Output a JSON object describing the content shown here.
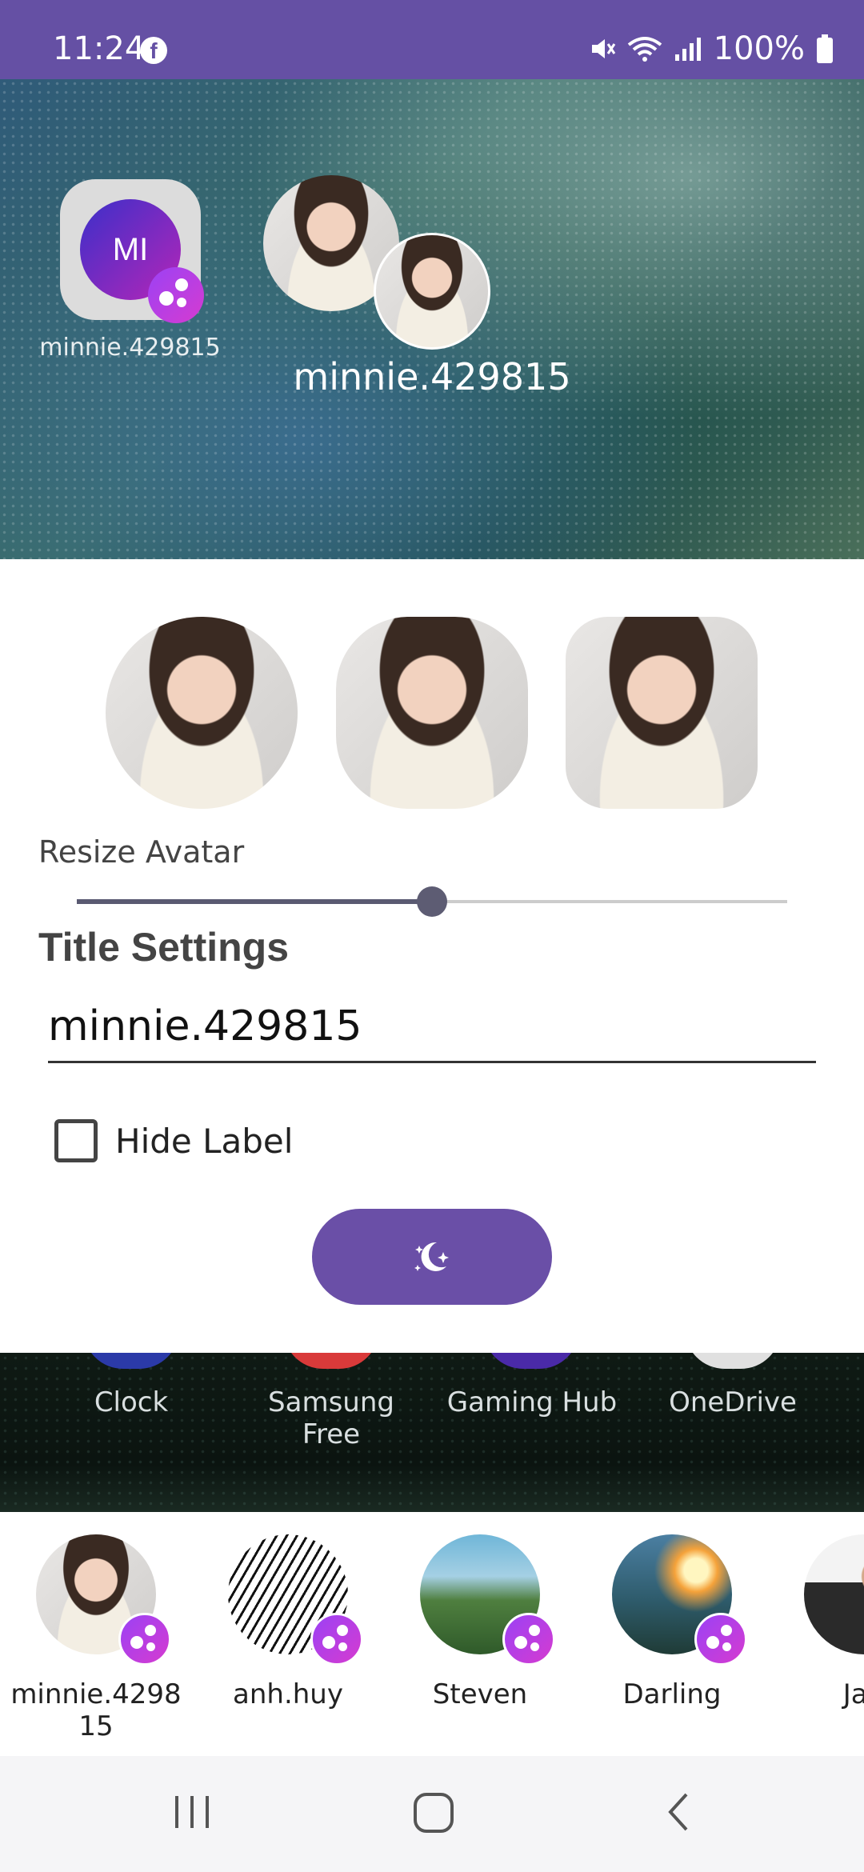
{
  "status_bar": {
    "time": "11:24",
    "battery": "100%",
    "icons": [
      "facebook-icon",
      "mute-icon",
      "wifi-icon",
      "signal-icon",
      "battery-icon"
    ],
    "background": "#6550a4"
  },
  "preview": {
    "widget_initials": "MI",
    "widget_label": "minnie.429815",
    "title": "minnie.429815"
  },
  "settings": {
    "shape_options": [
      "circle",
      "squircle",
      "rounded-square"
    ],
    "resize_label": "Resize Avatar",
    "resize_value": 0.5,
    "title_heading": "Title Settings",
    "title_value": "minnie.429815",
    "hide_label": "Hide Label",
    "hide_label_checked": false,
    "apply_icon": "magic-sparkle-icon",
    "accent": "#6a4fa7"
  },
  "home_apps": [
    {
      "label": "Clock",
      "color": "#2b3aa8"
    },
    {
      "label": "Samsung Free",
      "color": "#d93a3a"
    },
    {
      "label": "Gaming Hub",
      "color": "#4a2aa8"
    },
    {
      "label": "OneDrive",
      "color": "#e0e0e0"
    }
  ],
  "contacts": [
    {
      "name": "minnie.4298\n15"
    },
    {
      "name": "anh.huy"
    },
    {
      "name": "Steven"
    },
    {
      "name": "Darling"
    },
    {
      "name": "Jan"
    }
  ],
  "navbar": {
    "icons": [
      "recent-apps-icon",
      "home-icon",
      "back-icon"
    ]
  }
}
